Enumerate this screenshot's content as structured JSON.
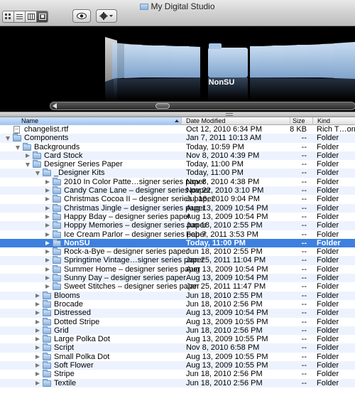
{
  "window": {
    "title": "My Digital Studio"
  },
  "toolbar": {
    "view_modes": [
      {
        "name": "icon-view-button",
        "active": false
      },
      {
        "name": "list-view-button",
        "active": false
      },
      {
        "name": "column-view-button",
        "active": false
      },
      {
        "name": "cover-flow-view-button",
        "active": true
      }
    ]
  },
  "coverflow": {
    "selected_label": "NonSU"
  },
  "columns": {
    "name": "Name",
    "date": "Date Modified",
    "size": "Size",
    "kind": "Kind"
  },
  "rows": [
    {
      "level": 0,
      "type": "file",
      "name": "changelist.rtf",
      "date": "Oct 12, 2010 6:34 PM",
      "size": "8 KB",
      "kind": "Rich T…ormat"
    },
    {
      "level": 0,
      "type": "folder",
      "open": true,
      "name": "Components",
      "date": "Jan 7, 2011 10:13 AM",
      "size": "--",
      "kind": "Folder"
    },
    {
      "level": 1,
      "type": "folder",
      "open": true,
      "name": "Backgrounds",
      "date": "Today, 10:59 PM",
      "size": "--",
      "kind": "Folder"
    },
    {
      "level": 2,
      "type": "folder",
      "open": false,
      "name": "Card Stock",
      "date": "Nov 8, 2010 4:39 PM",
      "size": "--",
      "kind": "Folder"
    },
    {
      "level": 2,
      "type": "folder",
      "open": true,
      "name": "Designer Series Paper",
      "date": "Today, 11:00 PM",
      "size": "--",
      "kind": "Folder"
    },
    {
      "level": 3,
      "type": "folder",
      "open": true,
      "name": "_Designer Kits",
      "date": "Today, 11:00 PM",
      "size": "--",
      "kind": "Folder"
    },
    {
      "level": 4,
      "type": "folder",
      "open": false,
      "name": "2010 In Color Patte…signer series paper",
      "date": "Nov 8, 2010 4:38 PM",
      "size": "--",
      "kind": "Folder"
    },
    {
      "level": 4,
      "type": "folder",
      "open": false,
      "name": "Candy Cane Lane – designer series paper",
      "date": "Nov 22, 2010 3:10 PM",
      "size": "--",
      "kind": "Folder"
    },
    {
      "level": 4,
      "type": "folder",
      "open": false,
      "name": "Christmas Cocoa II – designer series paper",
      "date": "Jul 16, 2010 9:04 PM",
      "size": "--",
      "kind": "Folder"
    },
    {
      "level": 4,
      "type": "folder",
      "open": false,
      "name": "Christmas Jingle – designer series paper",
      "date": "Aug 13, 2009 10:54 PM",
      "size": "--",
      "kind": "Folder"
    },
    {
      "level": 4,
      "type": "folder",
      "open": false,
      "name": "Happy Bday – designer series paper",
      "date": "Aug 13, 2009 10:54 PM",
      "size": "--",
      "kind": "Folder"
    },
    {
      "level": 4,
      "type": "folder",
      "open": false,
      "name": "Hoppy Memories – designer series paper",
      "date": "Jun 18, 2010 2:55 PM",
      "size": "--",
      "kind": "Folder"
    },
    {
      "level": 4,
      "type": "folder",
      "open": false,
      "name": "Ice Cream Parlor – designer series paper",
      "date": "Feb 7, 2011 3:53 PM",
      "size": "--",
      "kind": "Folder"
    },
    {
      "level": 4,
      "type": "folder",
      "open": false,
      "selected": true,
      "name": "NonSU",
      "date": "Today, 11:00 PM",
      "size": "--",
      "kind": "Folder"
    },
    {
      "level": 4,
      "type": "folder",
      "open": false,
      "name": "Rock-a-Bye – designer series paper",
      "date": "Jun 18, 2010 2:55 PM",
      "size": "--",
      "kind": "Folder"
    },
    {
      "level": 4,
      "type": "folder",
      "open": false,
      "name": "Springtime Vintage…signer series paper",
      "date": "Jan 25, 2011 11:04 PM",
      "size": "--",
      "kind": "Folder"
    },
    {
      "level": 4,
      "type": "folder",
      "open": false,
      "name": "Summer Home – designer series paper",
      "date": "Aug 13, 2009 10:54 PM",
      "size": "--",
      "kind": "Folder"
    },
    {
      "level": 4,
      "type": "folder",
      "open": false,
      "name": "Sunny Day – designer series paper",
      "date": "Aug 13, 2009 10:54 PM",
      "size": "--",
      "kind": "Folder"
    },
    {
      "level": 4,
      "type": "folder",
      "open": false,
      "name": "Sweet Stitches – designer series paper",
      "date": "Jan 25, 2011 11:47 PM",
      "size": "--",
      "kind": "Folder"
    },
    {
      "level": 3,
      "type": "folder",
      "open": false,
      "name": "Blooms",
      "date": "Jun 18, 2010 2:55 PM",
      "size": "--",
      "kind": "Folder"
    },
    {
      "level": 3,
      "type": "folder",
      "open": false,
      "name": "Brocade",
      "date": "Jun 18, 2010 2:56 PM",
      "size": "--",
      "kind": "Folder"
    },
    {
      "level": 3,
      "type": "folder",
      "open": false,
      "name": "Distressed",
      "date": "Aug 13, 2009 10:54 PM",
      "size": "--",
      "kind": "Folder"
    },
    {
      "level": 3,
      "type": "folder",
      "open": false,
      "name": "Dotted Stripe",
      "date": "Aug 13, 2009 10:55 PM",
      "size": "--",
      "kind": "Folder"
    },
    {
      "level": 3,
      "type": "folder",
      "open": false,
      "name": "Grid",
      "date": "Jun 18, 2010 2:56 PM",
      "size": "--",
      "kind": "Folder"
    },
    {
      "level": 3,
      "type": "folder",
      "open": false,
      "name": "Large Polka Dot",
      "date": "Aug 13, 2009 10:55 PM",
      "size": "--",
      "kind": "Folder"
    },
    {
      "level": 3,
      "type": "folder",
      "open": false,
      "name": "Script",
      "date": "Nov 8, 2010 6:58 PM",
      "size": "--",
      "kind": "Folder"
    },
    {
      "level": 3,
      "type": "folder",
      "open": false,
      "name": "Small Polka Dot",
      "date": "Aug 13, 2009 10:55 PM",
      "size": "--",
      "kind": "Folder"
    },
    {
      "level": 3,
      "type": "folder",
      "open": false,
      "name": "Soft Flower",
      "date": "Aug 13, 2009 10:55 PM",
      "size": "--",
      "kind": "Folder"
    },
    {
      "level": 3,
      "type": "folder",
      "open": false,
      "name": "Stripe",
      "date": "Jun 18, 2010 2:56 PM",
      "size": "--",
      "kind": "Folder"
    },
    {
      "level": 3,
      "type": "folder",
      "open": false,
      "name": "Textile",
      "date": "Jun 18, 2010 2:56 PM",
      "size": "--",
      "kind": "Folder"
    }
  ]
}
